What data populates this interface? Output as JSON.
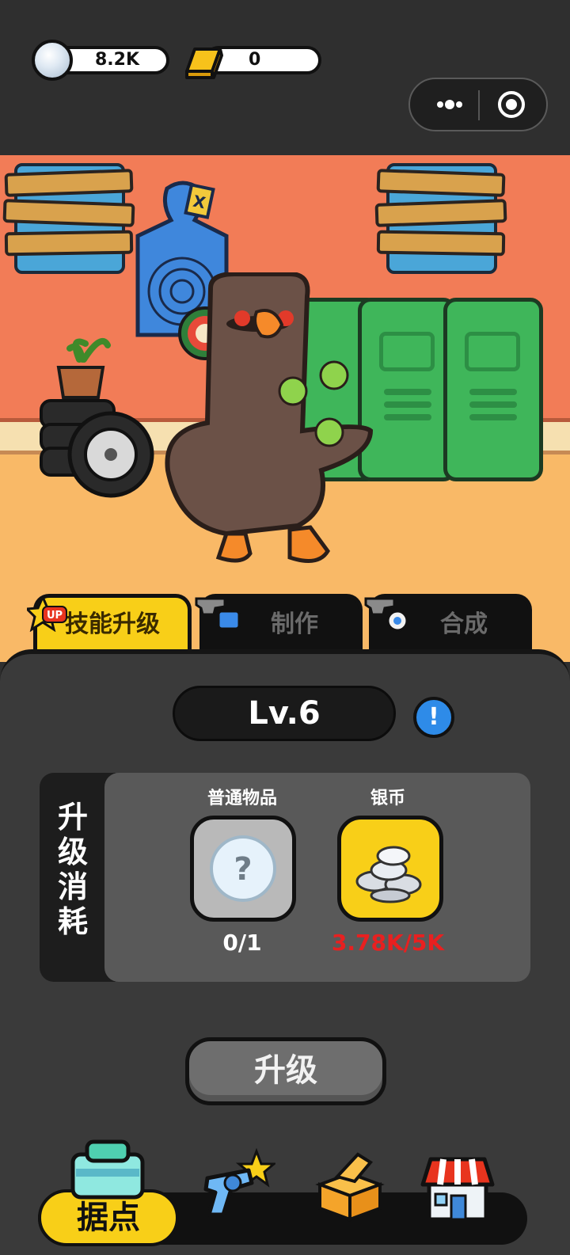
{
  "resources": [
    {
      "name": "silver",
      "value": "8.2K",
      "icon": "silver-coin-icon"
    },
    {
      "name": "gold",
      "value": "0",
      "icon": "gold-bar-icon"
    }
  ],
  "capsule": {
    "more_icon": "more-dots-icon",
    "close_icon": "target-close-icon"
  },
  "tabs": [
    {
      "label": "技能升级",
      "badge": "UP",
      "active": true
    },
    {
      "label": "制作",
      "active": false
    },
    {
      "label": "合成",
      "active": false
    }
  ],
  "panel": {
    "level": "Lv.6",
    "info": "!",
    "cost_label": "升级消耗",
    "costs": [
      {
        "name": "普通物品",
        "count": "0/1",
        "count_color": "#ffffff",
        "icon": "unknown-item-icon"
      },
      {
        "name": "银币",
        "count": "3.78K/5K",
        "count_color": "#e82020",
        "icon": "silver-coins-pile-icon"
      }
    ],
    "upgrade_button": "升级"
  },
  "nav": [
    {
      "label": "据点",
      "icon": "base-icon",
      "active": true
    },
    {
      "label": "",
      "icon": "revolver-icon",
      "active": false
    },
    {
      "label": "",
      "icon": "open-box-icon",
      "active": false
    },
    {
      "label": "",
      "icon": "shop-icon",
      "active": false
    }
  ],
  "colors": {
    "accent": "#f8cf18",
    "panel": "#3a3a3a",
    "warning": "#e82020",
    "info": "#2e8be8"
  }
}
